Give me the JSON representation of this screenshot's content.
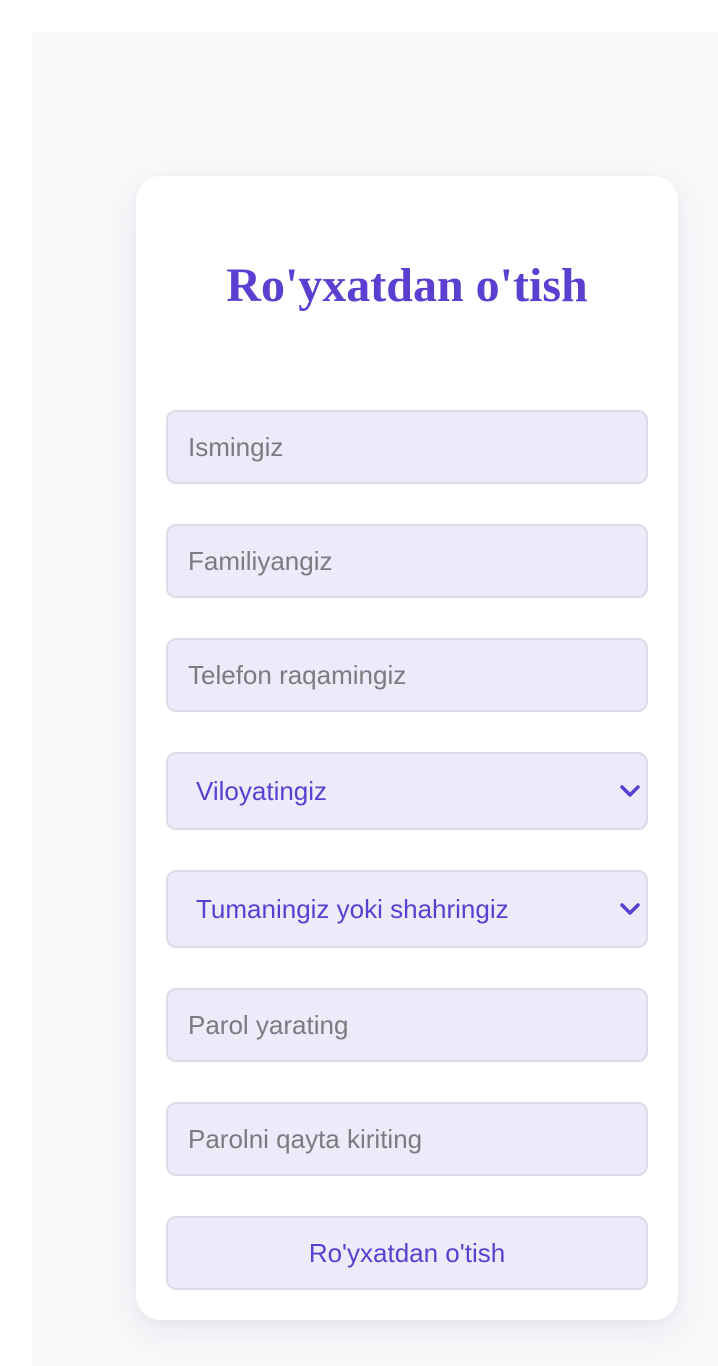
{
  "form": {
    "title": "Ro'yxatdan o'tish",
    "first_name": {
      "placeholder": "Ismingiz",
      "value": ""
    },
    "last_name": {
      "placeholder": "Familiyangiz",
      "value": ""
    },
    "phone": {
      "placeholder": "Telefon raqamingiz",
      "value": ""
    },
    "region": {
      "selected": "Viloyatingiz"
    },
    "district": {
      "selected": "Tumaningiz yoki shahringiz"
    },
    "password": {
      "placeholder": "Parol yarating",
      "value": ""
    },
    "password_confirm": {
      "placeholder": "Parolni qayta kiriting",
      "value": ""
    },
    "submit_label": "Ro'yxatdan o'tish"
  },
  "icons": {
    "region_dropdown": "chevron-down-icon",
    "district_dropdown": "chevron-down-icon"
  },
  "colors": {
    "accent": "#5a3fd0",
    "field_background": "#edeaf9",
    "field_border": "#dcdbe6",
    "page_background": "#f8f8fa",
    "card_background": "#ffffff",
    "placeholder_text": "#7b7b82"
  }
}
